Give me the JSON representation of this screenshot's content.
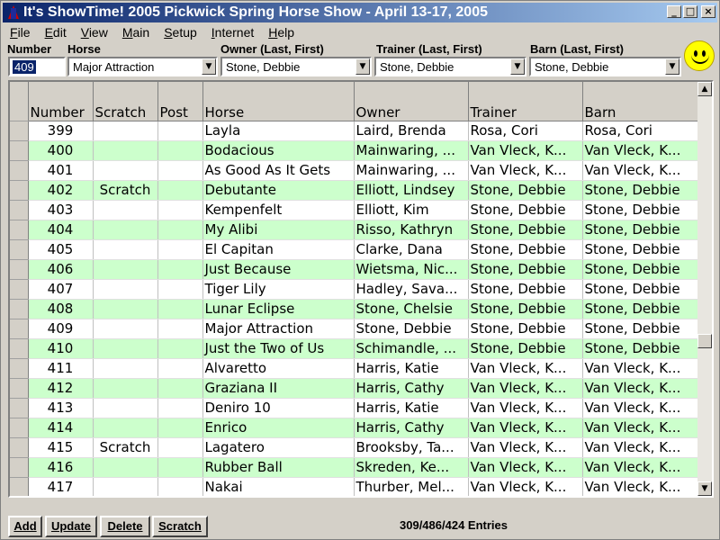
{
  "window": {
    "title": "It's ShowTime! 2005 Pickwick Spring Horse Show - April 13-17, 2005"
  },
  "menu": [
    "File",
    "Edit",
    "View",
    "Main",
    "Setup",
    "Internet",
    "Help"
  ],
  "filters": {
    "number_label": "Number",
    "number_value": "409",
    "horse_label": "Horse",
    "horse_value": "Major Attraction",
    "owner_label": "Owner (Last, First)",
    "owner_value": "Stone, Debbie",
    "trainer_label": "Trainer (Last, First)",
    "trainer_value": "Stone, Debbie",
    "barn_label": "Barn (Last, First)",
    "barn_value": "Stone, Debbie"
  },
  "table": {
    "columns": [
      "Number",
      "Scratch",
      "Post",
      "Horse",
      "Owner",
      "Trainer",
      "Barn"
    ],
    "rows": [
      {
        "number": "399",
        "scratch": "",
        "post": "",
        "horse": "Layla",
        "owner": "Laird, Brenda",
        "trainer": "Rosa, Cori",
        "barn": "Rosa, Cori"
      },
      {
        "number": "400",
        "scratch": "",
        "post": "",
        "horse": "Bodacious",
        "owner": "Mainwaring, ...",
        "trainer": "Van Vleck, K...",
        "barn": "Van Vleck, K..."
      },
      {
        "number": "401",
        "scratch": "",
        "post": "",
        "horse": "As Good As It Gets",
        "owner": "Mainwaring, ...",
        "trainer": "Van Vleck, K...",
        "barn": "Van Vleck, K..."
      },
      {
        "number": "402",
        "scratch": "Scratch",
        "post": "",
        "horse": "Debutante",
        "owner": "Elliott, Lindsey",
        "trainer": "Stone, Debbie",
        "barn": "Stone, Debbie"
      },
      {
        "number": "403",
        "scratch": "",
        "post": "",
        "horse": "Kempenfelt",
        "owner": "Elliott, Kim",
        "trainer": "Stone, Debbie",
        "barn": "Stone, Debbie"
      },
      {
        "number": "404",
        "scratch": "",
        "post": "",
        "horse": "My Alibi",
        "owner": "Risso, Kathryn",
        "trainer": "Stone, Debbie",
        "barn": "Stone, Debbie"
      },
      {
        "number": "405",
        "scratch": "",
        "post": "",
        "horse": "El Capitan",
        "owner": "Clarke, Dana",
        "trainer": "Stone, Debbie",
        "barn": "Stone, Debbie"
      },
      {
        "number": "406",
        "scratch": "",
        "post": "",
        "horse": "Just Because",
        "owner": "Wietsma, Nic...",
        "trainer": "Stone, Debbie",
        "barn": "Stone, Debbie"
      },
      {
        "number": "407",
        "scratch": "",
        "post": "",
        "horse": "Tiger Lily",
        "owner": "Hadley, Sava...",
        "trainer": "Stone, Debbie",
        "barn": "Stone, Debbie"
      },
      {
        "number": "408",
        "scratch": "",
        "post": "",
        "horse": "Lunar Eclipse",
        "owner": "Stone, Chelsie",
        "trainer": "Stone, Debbie",
        "barn": "Stone, Debbie"
      },
      {
        "number": "409",
        "scratch": "",
        "post": "",
        "horse": "Major Attraction",
        "owner": "Stone, Debbie",
        "trainer": "Stone, Debbie",
        "barn": "Stone, Debbie"
      },
      {
        "number": "410",
        "scratch": "",
        "post": "",
        "horse": "Just the Two of Us",
        "owner": "Schimandle, ...",
        "trainer": "Stone, Debbie",
        "barn": "Stone, Debbie"
      },
      {
        "number": "411",
        "scratch": "",
        "post": "",
        "horse": "Alvaretto",
        "owner": "Harris, Katie",
        "trainer": "Van Vleck, K...",
        "barn": "Van Vleck, K..."
      },
      {
        "number": "412",
        "scratch": "",
        "post": "",
        "horse": "Graziana II",
        "owner": "Harris, Cathy",
        "trainer": "Van Vleck, K...",
        "barn": "Van Vleck, K..."
      },
      {
        "number": "413",
        "scratch": "",
        "post": "",
        "horse": "Deniro 10",
        "owner": "Harris, Katie",
        "trainer": "Van Vleck, K...",
        "barn": "Van Vleck, K..."
      },
      {
        "number": "414",
        "scratch": "",
        "post": "",
        "horse": "Enrico",
        "owner": "Harris, Cathy",
        "trainer": "Van Vleck, K...",
        "barn": "Van Vleck, K..."
      },
      {
        "number": "415",
        "scratch": "Scratch",
        "post": "",
        "horse": "Lagatero",
        "owner": "Brooksby, Ta...",
        "trainer": "Van Vleck, K...",
        "barn": "Van Vleck, K..."
      },
      {
        "number": "416",
        "scratch": "",
        "post": "",
        "horse": "Rubber Ball",
        "owner": "Skreden, Ke...",
        "trainer": "Van Vleck, K...",
        "barn": "Van Vleck, K..."
      },
      {
        "number": "417",
        "scratch": "",
        "post": "",
        "horse": "Nakai",
        "owner": "Thurber, Mel...",
        "trainer": "Van Vleck, K...",
        "barn": "Van Vleck, K..."
      }
    ]
  },
  "buttons": {
    "add": "Add",
    "update": "Update",
    "delete": "Delete",
    "scratch": "Scratch"
  },
  "status": "309/486/424 Entries",
  "colors": {
    "title_start": "#0a246a",
    "row_alt": "#ccffcc",
    "selection": "#0a246a"
  }
}
